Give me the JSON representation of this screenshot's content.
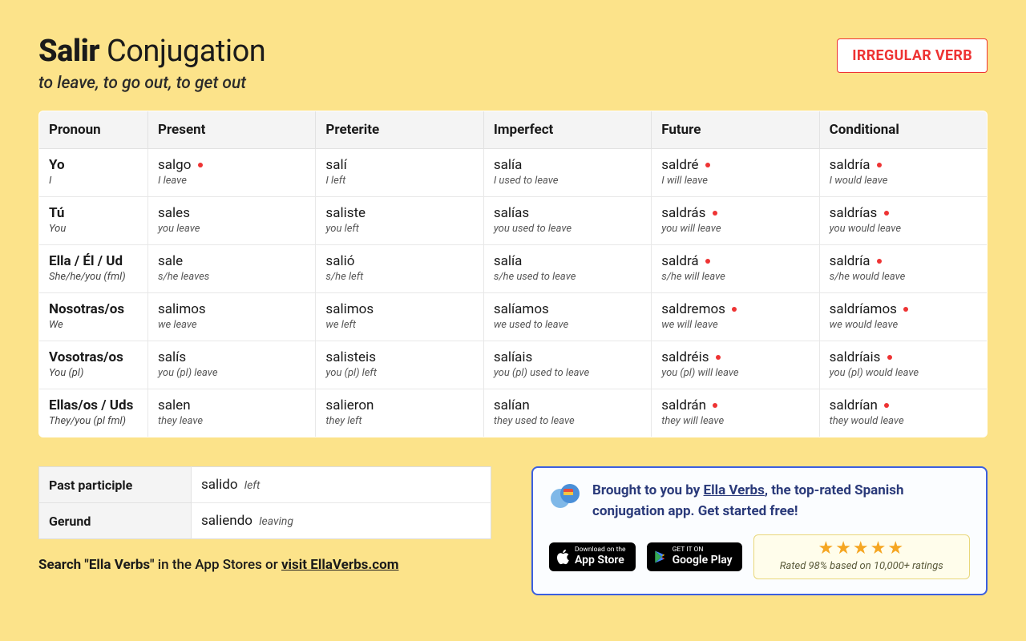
{
  "header": {
    "verb": "Salir",
    "title_suffix": "Conjugation",
    "meaning": "to leave, to go out, to get out",
    "badge": "IRREGULAR VERB"
  },
  "columns": [
    "Pronoun",
    "Present",
    "Preterite",
    "Imperfect",
    "Future",
    "Conditional"
  ],
  "rows": [
    {
      "pronoun": {
        "main": "Yo",
        "sub": "I"
      },
      "cells": [
        {
          "main": "salgo",
          "sub": "I leave",
          "irregular": true
        },
        {
          "main": "salí",
          "sub": "I left",
          "irregular": false
        },
        {
          "main": "salía",
          "sub": "I used to leave",
          "irregular": false
        },
        {
          "main": "saldré",
          "sub": "I will leave",
          "irregular": true
        },
        {
          "main": "saldría",
          "sub": "I would leave",
          "irregular": true
        }
      ]
    },
    {
      "pronoun": {
        "main": "Tú",
        "sub": "You"
      },
      "cells": [
        {
          "main": "sales",
          "sub": "you leave",
          "irregular": false
        },
        {
          "main": "saliste",
          "sub": "you left",
          "irregular": false
        },
        {
          "main": "salías",
          "sub": "you used to leave",
          "irregular": false
        },
        {
          "main": "saldrás",
          "sub": "you will leave",
          "irregular": true
        },
        {
          "main": "saldrías",
          "sub": "you would leave",
          "irregular": true
        }
      ]
    },
    {
      "pronoun": {
        "main": "Ella / Él / Ud",
        "sub": "She/he/you (fml)"
      },
      "cells": [
        {
          "main": "sale",
          "sub": "s/he leaves",
          "irregular": false
        },
        {
          "main": "salió",
          "sub": "s/he left",
          "irregular": false
        },
        {
          "main": "salía",
          "sub": "s/he used to leave",
          "irregular": false
        },
        {
          "main": "saldrá",
          "sub": "s/he will leave",
          "irregular": true
        },
        {
          "main": "saldría",
          "sub": "s/he would leave",
          "irregular": true
        }
      ]
    },
    {
      "pronoun": {
        "main": "Nosotras/os",
        "sub": "We"
      },
      "cells": [
        {
          "main": "salimos",
          "sub": "we leave",
          "irregular": false
        },
        {
          "main": "salimos",
          "sub": "we left",
          "irregular": false
        },
        {
          "main": "salíamos",
          "sub": "we used to leave",
          "irregular": false
        },
        {
          "main": "saldremos",
          "sub": "we will leave",
          "irregular": true
        },
        {
          "main": "saldríamos",
          "sub": "we would leave",
          "irregular": true
        }
      ]
    },
    {
      "pronoun": {
        "main": "Vosotras/os",
        "sub": "You (pl)"
      },
      "cells": [
        {
          "main": "salís",
          "sub": "you (pl) leave",
          "irregular": false
        },
        {
          "main": "salisteis",
          "sub": "you (pl) left",
          "irregular": false
        },
        {
          "main": "salíais",
          "sub": "you (pl) used to leave",
          "irregular": false
        },
        {
          "main": "saldréis",
          "sub": "you (pl) will leave",
          "irregular": true
        },
        {
          "main": "saldríais",
          "sub": "you (pl) would leave",
          "irregular": true
        }
      ]
    },
    {
      "pronoun": {
        "main": "Ellas/os / Uds",
        "sub": "They/you (pl fml)"
      },
      "cells": [
        {
          "main": "salen",
          "sub": "they leave",
          "irregular": false
        },
        {
          "main": "salieron",
          "sub": "they left",
          "irregular": false
        },
        {
          "main": "salían",
          "sub": "they used to leave",
          "irregular": false
        },
        {
          "main": "saldrán",
          "sub": "they will leave",
          "irregular": true
        },
        {
          "main": "saldrían",
          "sub": "they would leave",
          "irregular": true
        }
      ]
    }
  ],
  "participles": [
    {
      "label": "Past participle",
      "form": "salido",
      "trans": "left"
    },
    {
      "label": "Gerund",
      "form": "saliendo",
      "trans": "leaving"
    }
  ],
  "search_line": {
    "bold": "Search \"Ella Verbs\"",
    "mid": " in the App Stores or ",
    "link": "visit EllaVerbs.com"
  },
  "promo": {
    "prefix": "Brought to you by ",
    "brand": "Ella Verbs",
    "suffix": ", the top-rated Spanish conjugation app. Get started free!",
    "appstore": {
      "small": "Download on the",
      "big": "App Store"
    },
    "play": {
      "small": "GET IT ON",
      "big": "Google Play"
    },
    "rating": {
      "stars": "★★★★★",
      "text": "Rated 98% based on 10,000+ ratings"
    }
  }
}
